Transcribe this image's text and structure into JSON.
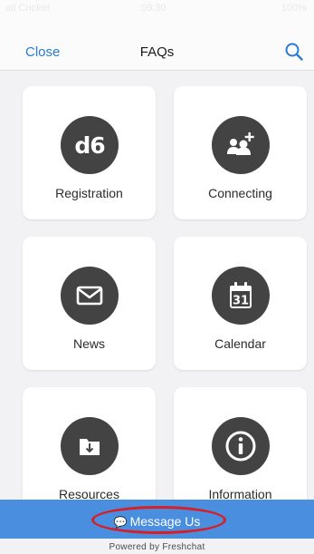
{
  "status_bar": {
    "carrier": "atl Cricket",
    "time": "09:30",
    "battery": "100%"
  },
  "nav": {
    "close_label": "Close",
    "title": "FAQs",
    "search_icon": "search-icon"
  },
  "tiles": [
    {
      "label": "Registration",
      "icon": "d6-logo-icon",
      "icon_text": "d6"
    },
    {
      "label": "Connecting",
      "icon": "add-user-icon"
    },
    {
      "label": "News",
      "icon": "envelope-icon"
    },
    {
      "label": "Calendar",
      "icon": "calendar-icon",
      "icon_text": "31"
    },
    {
      "label": "Resources",
      "icon": "folder-download-icon"
    },
    {
      "label": "Information",
      "icon": "info-icon"
    }
  ],
  "footer": {
    "message_label": "Message Us",
    "powered_by": "Powered by Freshchat"
  },
  "colors": {
    "accent": "#2a7bd1",
    "bar": "#4a8ee0",
    "icon_bg": "#434343",
    "highlight": "#d61f26"
  }
}
